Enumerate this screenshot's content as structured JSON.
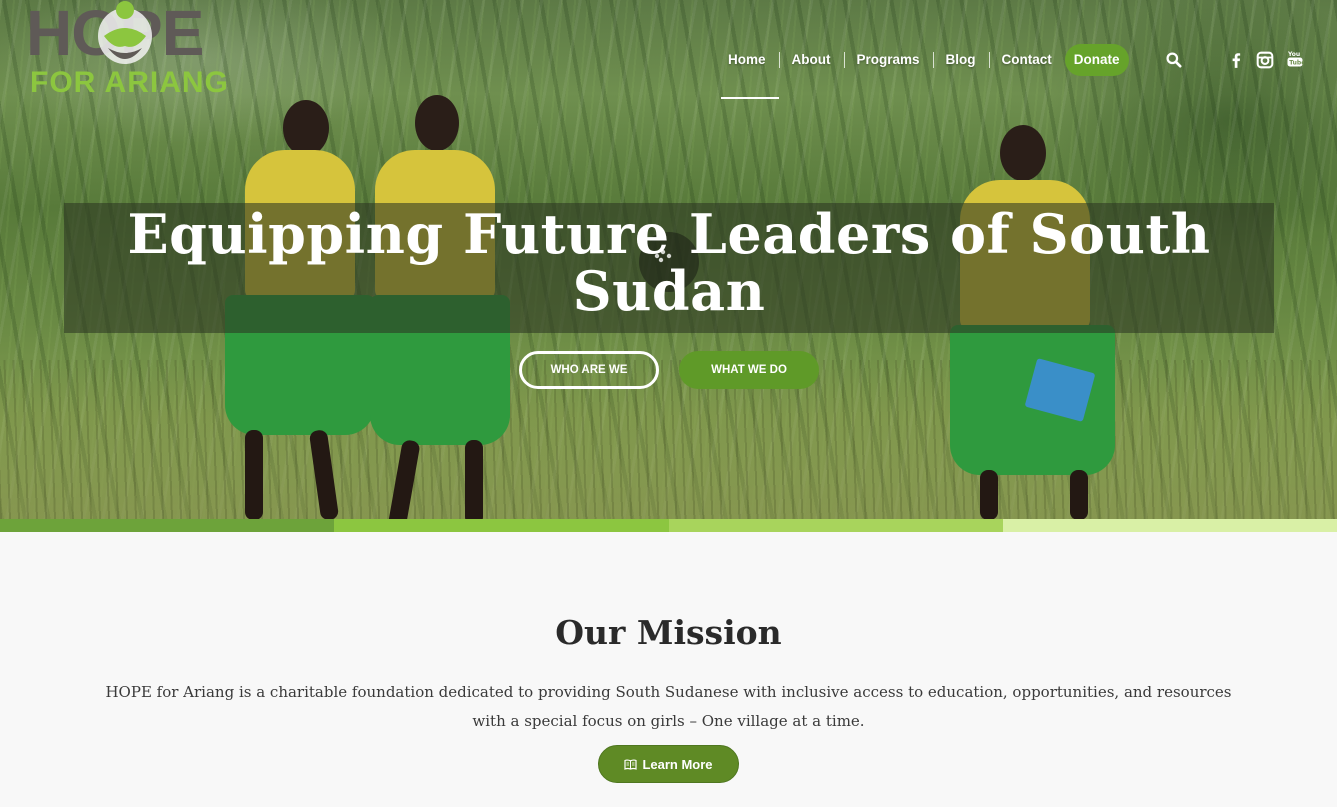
{
  "logo": {
    "line1": "HOPE",
    "line2": "FOR ARIANG",
    "primary_color": "#5f5a57",
    "accent_color": "#8cc63f"
  },
  "nav": {
    "items": [
      {
        "label": "Home",
        "active": true
      },
      {
        "label": "About",
        "active": false
      },
      {
        "label": "Programs",
        "active": false
      },
      {
        "label": "Blog",
        "active": false
      },
      {
        "label": "Contact",
        "active": false
      }
    ],
    "donate_label": "Donate",
    "icons": [
      "search-icon",
      "facebook-icon",
      "instagram-icon",
      "youtube-icon"
    ]
  },
  "hero": {
    "title": "Equipping Future Leaders of South Sudan",
    "buttons": {
      "who": "WHO ARE WE",
      "what": "WHAT WE DO"
    },
    "play_icon": "play-icon"
  },
  "stripe_colors": [
    "#6da33a",
    "#8cc640",
    "#a8d45c",
    "#d9f0a6"
  ],
  "mission": {
    "title": "Our Mission",
    "text": "HOPE for Ariang is a charitable foundation dedicated to providing South Sudanese with inclusive access to education, opportunities, and resources with a special focus on girls – One village at a time.",
    "button_label": "Learn More",
    "button_icon": "book-icon"
  },
  "colors": {
    "brand_green": "#5f9a28",
    "text_dark": "#2a2a2a"
  }
}
